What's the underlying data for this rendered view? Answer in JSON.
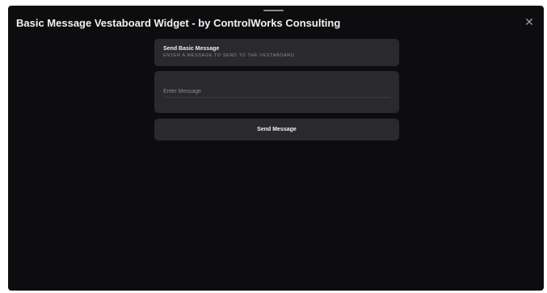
{
  "window": {
    "title": "Basic Message Vestaboard Widget - by ControlWorks Consulting",
    "close_icon": "close-icon",
    "close_glyph": "✕"
  },
  "header_card": {
    "title": "Send Basic Message",
    "subtitle": "ENTER A MESSAGE TO SEND TO THE VESTABOARD"
  },
  "message_input": {
    "placeholder": "Enter Message",
    "value": ""
  },
  "send_button": {
    "label": "Send Message"
  },
  "colors": {
    "background": "#0d0d0f",
    "card": "#2a2a2e",
    "text": "#f2f2f2",
    "muted_text": "#8c8c92"
  }
}
